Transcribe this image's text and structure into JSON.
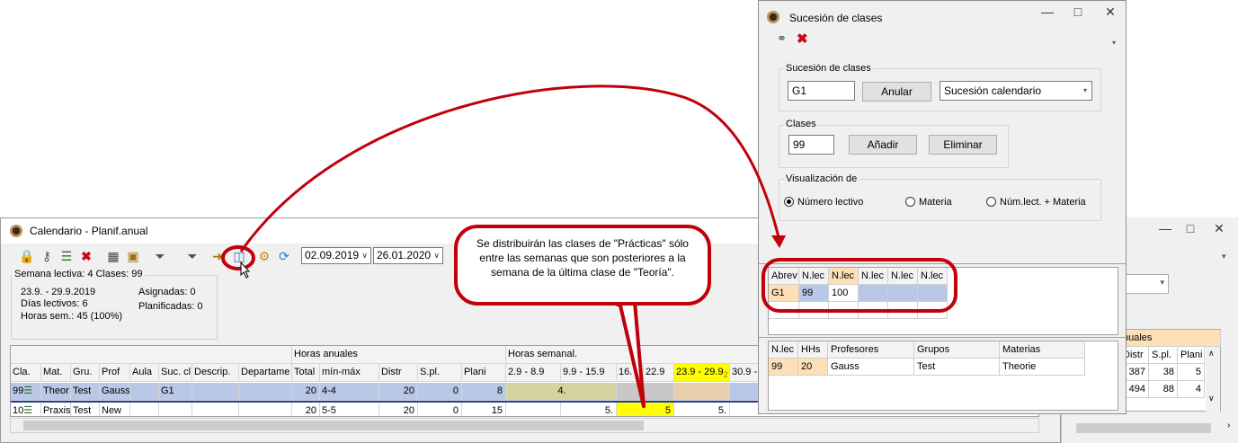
{
  "calendar_window": {
    "title": "Calendario - Planif.anual",
    "date_from": "02.09.2019",
    "date_to": "26.01.2020",
    "info": {
      "legend": "Semana lectiva: 4  Clases: 99",
      "range": "23.9. - 29.9.2019",
      "dias": "Días lectivos: 6",
      "horas": "Horas sem.: 45 (100%)",
      "asignadas": "Asignadas: 0",
      "planificadas": "Planificadas: 0"
    },
    "group_headers": {
      "horas_anuales": "Horas anuales",
      "horas_semanal": "Horas semanal."
    },
    "columns": [
      "Cla.",
      "Mat.",
      "Gru.",
      "Prof",
      "Aula",
      "Suc. cl",
      "Descrip.",
      "Departame",
      "Total",
      "mín-máx",
      "Distr",
      "S.pl.",
      "Plani",
      "2.9 - 8.9",
      "9.9 - 15.9",
      "16.",
      "22.9",
      "23.9 - 29.9",
      "30.9 -"
    ],
    "week_marker": "2",
    "rows": [
      {
        "cla": "99",
        "mat": "Theor",
        "gru": "Test",
        "prof": "Gauss",
        "aula": "",
        "suc": "G1",
        "total": "20",
        "minmax": "4-4",
        "distr": "20",
        "spl": "0",
        "plani": "8",
        "week1": "4."
      },
      {
        "cla": "10",
        "mat": "Praxis",
        "gru": "Test",
        "prof": "New",
        "aula": "",
        "suc": "",
        "total": "20",
        "minmax": "5-5",
        "distr": "20",
        "spl": "0",
        "plani": "15",
        "week2": "5.",
        "week3": "5",
        "week4": "5."
      }
    ]
  },
  "background_window": {
    "group_header": "nuales",
    "columns": [
      "Distr",
      "S.pl.",
      "Plani"
    ],
    "rows": [
      [
        "387",
        "38",
        "5"
      ],
      [
        "494",
        "88",
        "4"
      ]
    ]
  },
  "dialog": {
    "title": "Sucesión de clases",
    "sucesion": {
      "legend": "Sucesión de clases",
      "value": "G1",
      "anular_label": "Anular",
      "select_value": "Sucesión calendario"
    },
    "clases": {
      "legend": "Clases",
      "value": "99",
      "anadir_label": "Añadir",
      "eliminar_label": "Eliminar"
    },
    "visualizacion": {
      "legend": "Visualización de",
      "options": [
        "Número lectivo",
        "Materia",
        "Núm.lect. + Materia"
      ],
      "selected": 0
    },
    "seq_grid": {
      "headers": [
        "Abrev",
        "N.lec",
        "N.lec",
        "N.lec",
        "N.lec",
        "N.lec"
      ],
      "row": [
        "G1",
        "99",
        "100",
        "",
        "",
        ""
      ]
    },
    "detail_grid": {
      "headers": [
        "N.lec",
        "HHs",
        "Profesores",
        "Grupos",
        "Materias"
      ],
      "row": [
        "99",
        "20",
        "Gauss",
        "Test",
        "Theorie"
      ]
    }
  },
  "callout": {
    "text": "Se distribuirán las clases de \"Prácticas\" sólo entre las semanas que son posteriores a la semana de la última clase de \"Teoría\"."
  },
  "colors": {
    "highlight": "#c0000a",
    "selected_row": "#b9c8e6",
    "yellow": "#ffff00",
    "header_accent": "#fde0b8"
  }
}
